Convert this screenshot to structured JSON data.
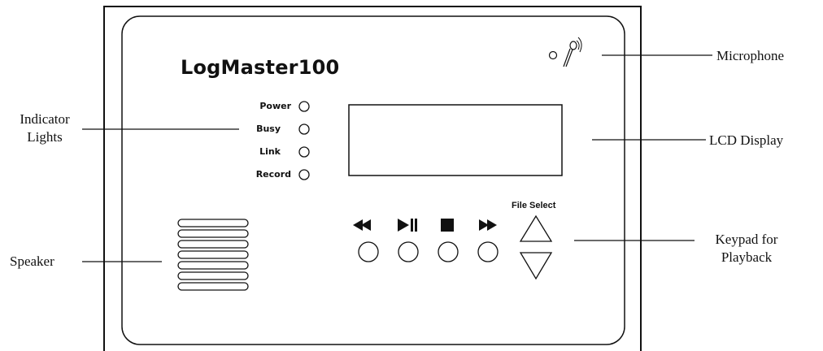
{
  "device": {
    "title": "LogMaster100",
    "indicators": [
      {
        "label": "Power"
      },
      {
        "label": "Busy"
      },
      {
        "label": "Link"
      },
      {
        "label": "Record"
      }
    ],
    "file_select_label": "File Select"
  },
  "callouts": {
    "microphone": "Microphone",
    "indicator_lights": [
      "Indicator",
      "Lights"
    ],
    "lcd_display": "LCD Display",
    "speaker": "Speaker",
    "keypad": [
      "Keypad for",
      "Playback"
    ]
  },
  "icons": {
    "keys": [
      "rewind-icon",
      "play-pause-icon",
      "stop-icon",
      "fast-forward-icon"
    ],
    "file_select": [
      "triangle-up-icon",
      "triangle-down-icon"
    ],
    "mic": "microphone-icon"
  }
}
